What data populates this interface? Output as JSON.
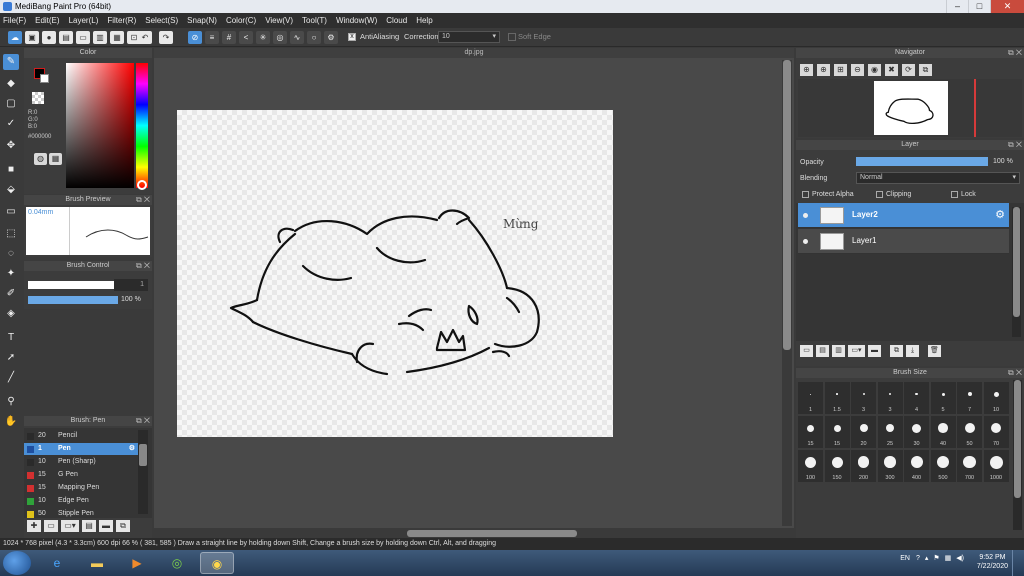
{
  "window": {
    "title": "MediBang Paint Pro (64bit)",
    "min": "–",
    "max": "□",
    "close": "✕"
  },
  "menu": [
    "File(F)",
    "Edit(E)",
    "Layer(L)",
    "Filter(R)",
    "Select(S)",
    "Snap(N)",
    "Color(C)",
    "View(V)",
    "Tool(T)",
    "Window(W)",
    "Cloud",
    "Help"
  ],
  "toolbar": {
    "antialiasing_label": "AntiAliasing",
    "correction_label": "Correction",
    "correction_value": "10",
    "soft_edge_label": "Soft Edge"
  },
  "color_panel": {
    "title": "Color",
    "r": "R:0",
    "g": "G:0",
    "b": "B:0",
    "hex": "#000000",
    "primary": "#000000",
    "secondary": "#ffffff",
    "accent": "#d21b1b"
  },
  "brush_preview": {
    "title": "Brush Preview",
    "size": "0.04mm"
  },
  "brush_control": {
    "title": "Brush Control",
    "size_value": "1",
    "opacity_value": "100 %"
  },
  "brush_list": {
    "title": "Brush: Pen",
    "items": [
      {
        "size": "20",
        "name": "Pencil",
        "color": "#2a2a2a"
      },
      {
        "size": "1",
        "name": "Pen",
        "color": "#1e4fa0"
      },
      {
        "size": "10",
        "name": "Pen (Sharp)",
        "color": "#2a2a2a"
      },
      {
        "size": "15",
        "name": "G Pen",
        "color": "#d23030"
      },
      {
        "size": "15",
        "name": "Mapping Pen",
        "color": "#d23030"
      },
      {
        "size": "10",
        "name": "Edge Pen",
        "color": "#2fa23a"
      },
      {
        "size": "50",
        "name": "Stipple Pen",
        "color": "#e0c21a"
      }
    ]
  },
  "canvas": {
    "doc_tab": "dp.jpg",
    "signature": "Mừng"
  },
  "navigator": {
    "title": "Navigator"
  },
  "layer_panel": {
    "title": "Layer",
    "opacity_label": "Opacity",
    "opacity_value": "100 %",
    "blending_label": "Blending",
    "blending_value": "Normal",
    "protect_alpha": "Protect Alpha",
    "clipping": "Clipping",
    "lock": "Lock",
    "layers": [
      "Layer2",
      "Layer1"
    ]
  },
  "brush_size": {
    "title": "Brush Size",
    "sizes": [
      "1",
      "1.5",
      "3",
      "3",
      "4",
      "5",
      "7",
      "10",
      "15",
      "15",
      "20",
      "25",
      "30",
      "40",
      "50",
      "70",
      "100",
      "150",
      "200",
      "300",
      "400",
      "500",
      "700",
      "1000"
    ]
  },
  "status": "1024 * 768 pixel   (4.3 * 3.3cm)   600 dpi   66 %   ( 381, 585 )   Draw a straight line by holding down Shift, Change a brush size by holding down Ctrl, Alt, and dragging",
  "taskbar": {
    "lang": "EN",
    "time": "9:52 PM",
    "date": "7/22/2020"
  }
}
